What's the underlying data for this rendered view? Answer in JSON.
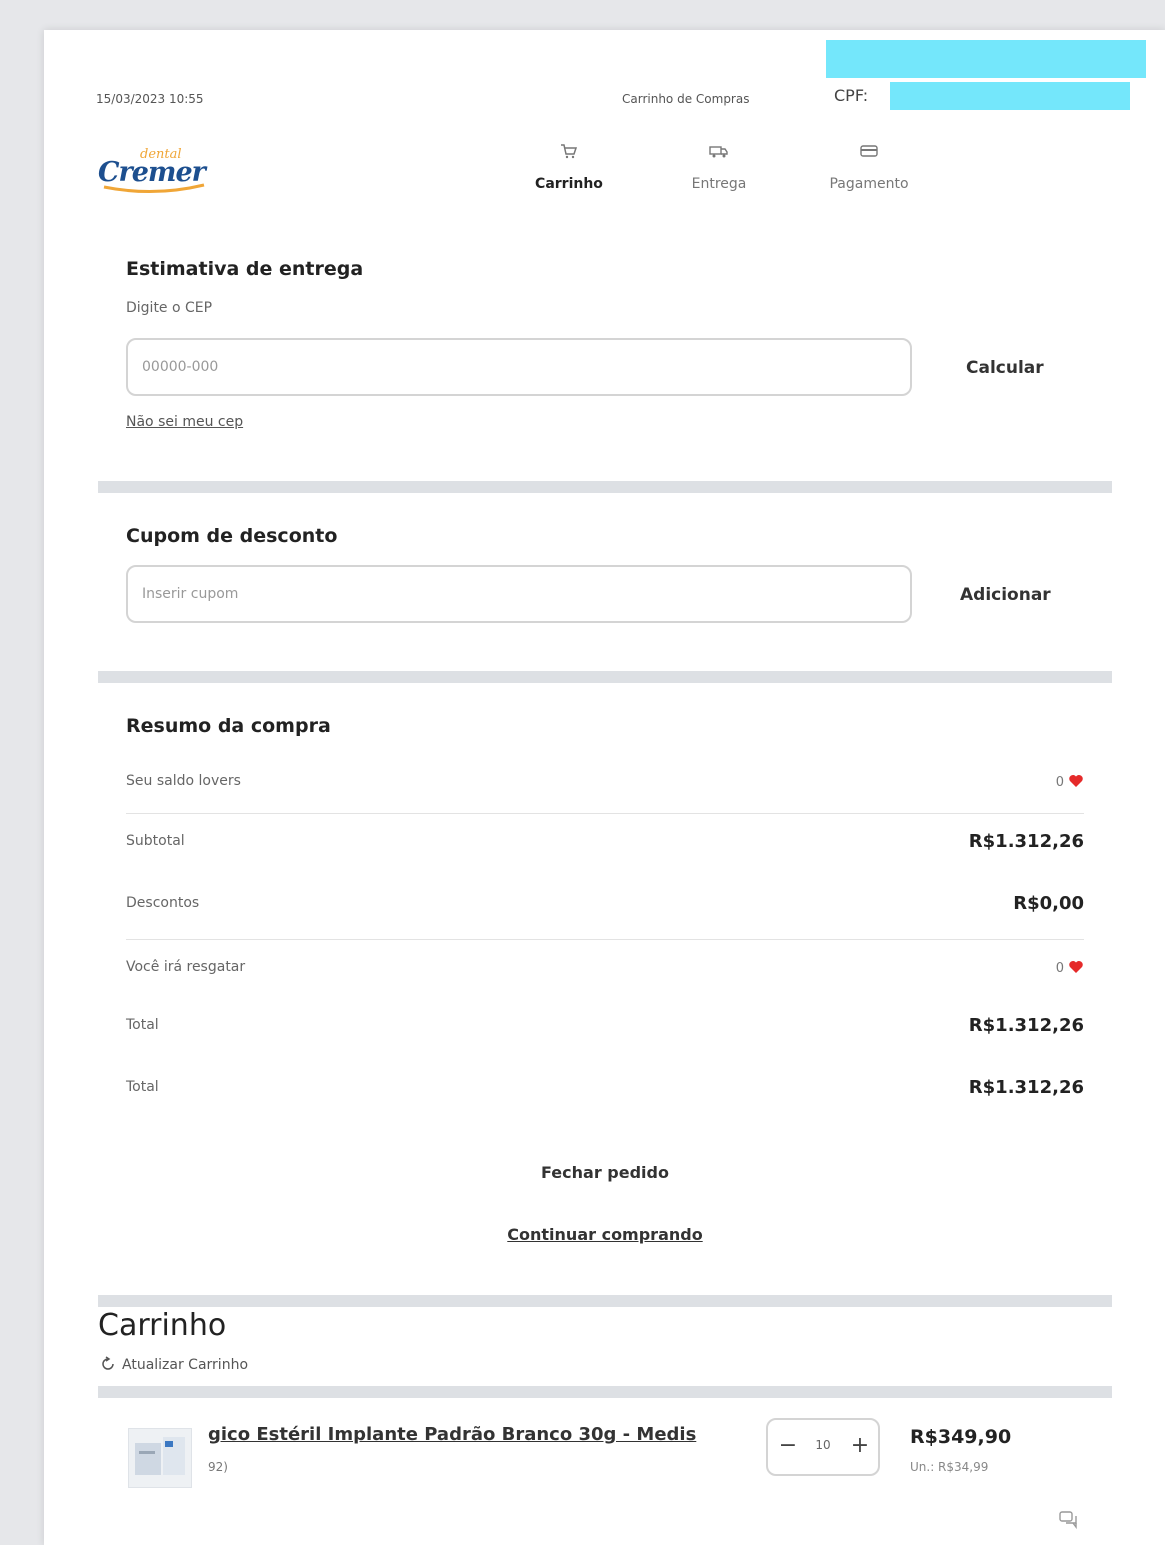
{
  "print_header": {
    "datetime": "15/03/2023 10:55",
    "title": "Carrinho de Compras",
    "cpf_label": "CPF:"
  },
  "logo": {
    "small_text": "dental",
    "brand": "Cremer"
  },
  "steps": [
    {
      "label": "Carrinho",
      "icon": "cart-icon",
      "active": true
    },
    {
      "label": "Entrega",
      "icon": "truck-icon",
      "active": false
    },
    {
      "label": "Pagamento",
      "icon": "card-icon",
      "active": false
    }
  ],
  "delivery": {
    "title": "Estimativa de entrega",
    "field_label": "Digite o CEP",
    "placeholder": "00000-000",
    "calculate_label": "Calcular",
    "unknown_cep_link": "Não sei meu cep"
  },
  "coupon": {
    "title": "Cupom de desconto",
    "placeholder": "Inserir cupom",
    "add_label": "Adicionar"
  },
  "summary": {
    "title": "Resumo da compra",
    "rows": [
      {
        "label": "Seu saldo lovers",
        "value": "0",
        "heart": true
      },
      {
        "label": "Subtotal",
        "value": "R$1.312,26"
      },
      {
        "label": "Descontos",
        "value": "R$0,00"
      },
      {
        "label": "Você irá resgatar",
        "value": "0",
        "heart": true
      },
      {
        "label": "Total",
        "value": "R$1.312,26"
      },
      {
        "label": "Total",
        "value": "R$1.312,26"
      }
    ],
    "close_order_label": "Fechar pedido",
    "continue_shopping_label": "Continuar comprando"
  },
  "cart": {
    "title": "Carrinho",
    "refresh_label": "Atualizar Carrinho",
    "items": [
      {
        "name": "gico Estéril Implante Padrão Branco 30g - Medis",
        "sku": "92)",
        "quantity": "10",
        "price": "R$349,90",
        "unit_price": "Un.: R$34,99"
      }
    ]
  },
  "colors": {
    "heart": "#e52a2a",
    "redaction": "#74e7fb",
    "brand_blue": "#1d4f8f",
    "brand_orange": "#f0a637"
  }
}
